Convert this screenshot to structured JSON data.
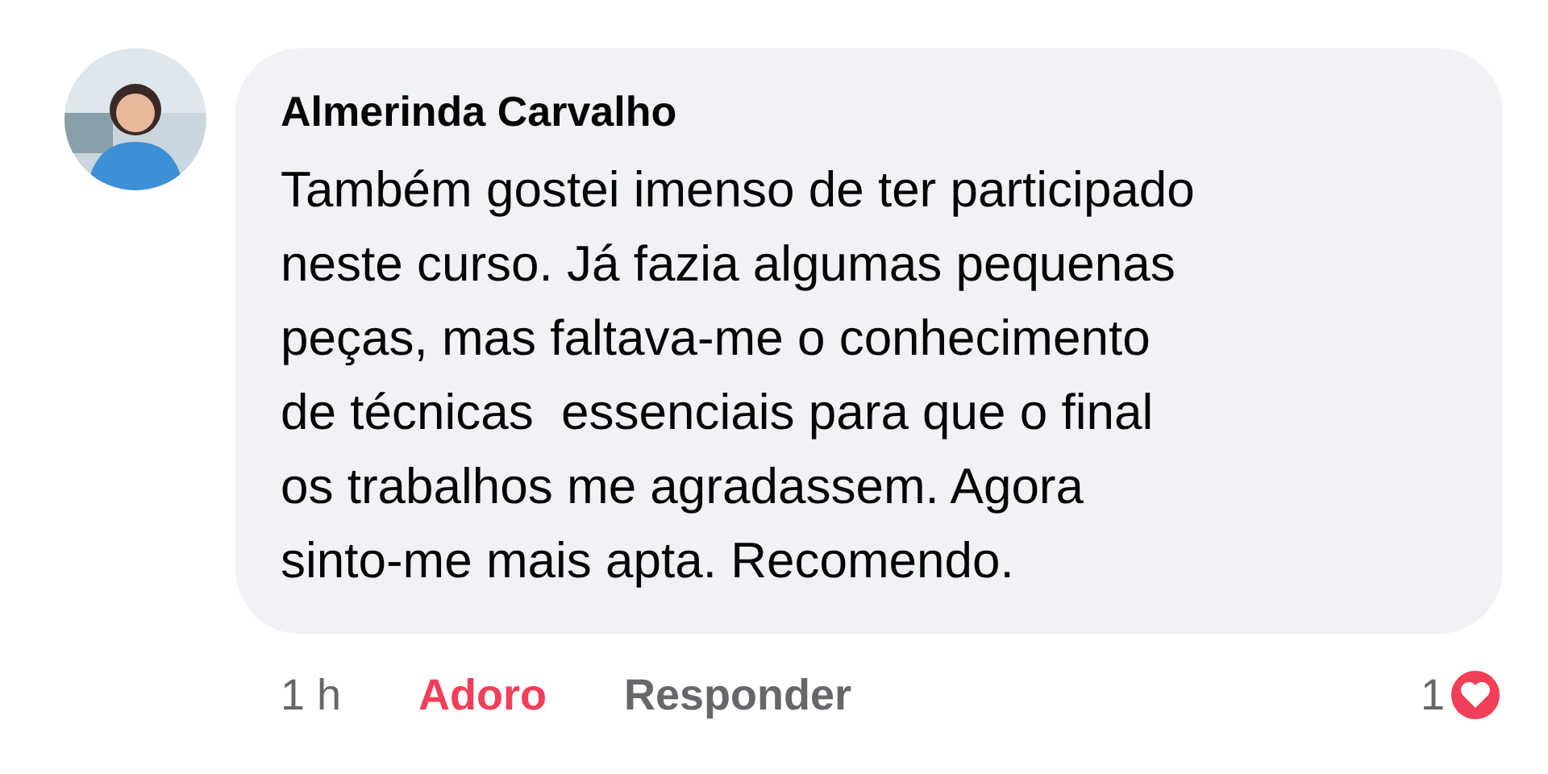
{
  "comment": {
    "author": "Almerinda Carvalho",
    "text": "Também gostei imenso de ter participado\nneste curso. Já fazia algumas pequenas\npeças, mas faltava-me o conhecimento\nde técnicas  essenciais para que o final\nos trabalhos me agradassem. Agora\nsinto-me mais apta. Recomendo.",
    "time": "1 h",
    "reaction_button": {
      "label": "Adoro",
      "active": true
    },
    "reply_button": {
      "label": "Responder"
    },
    "reaction_count": "1"
  }
}
